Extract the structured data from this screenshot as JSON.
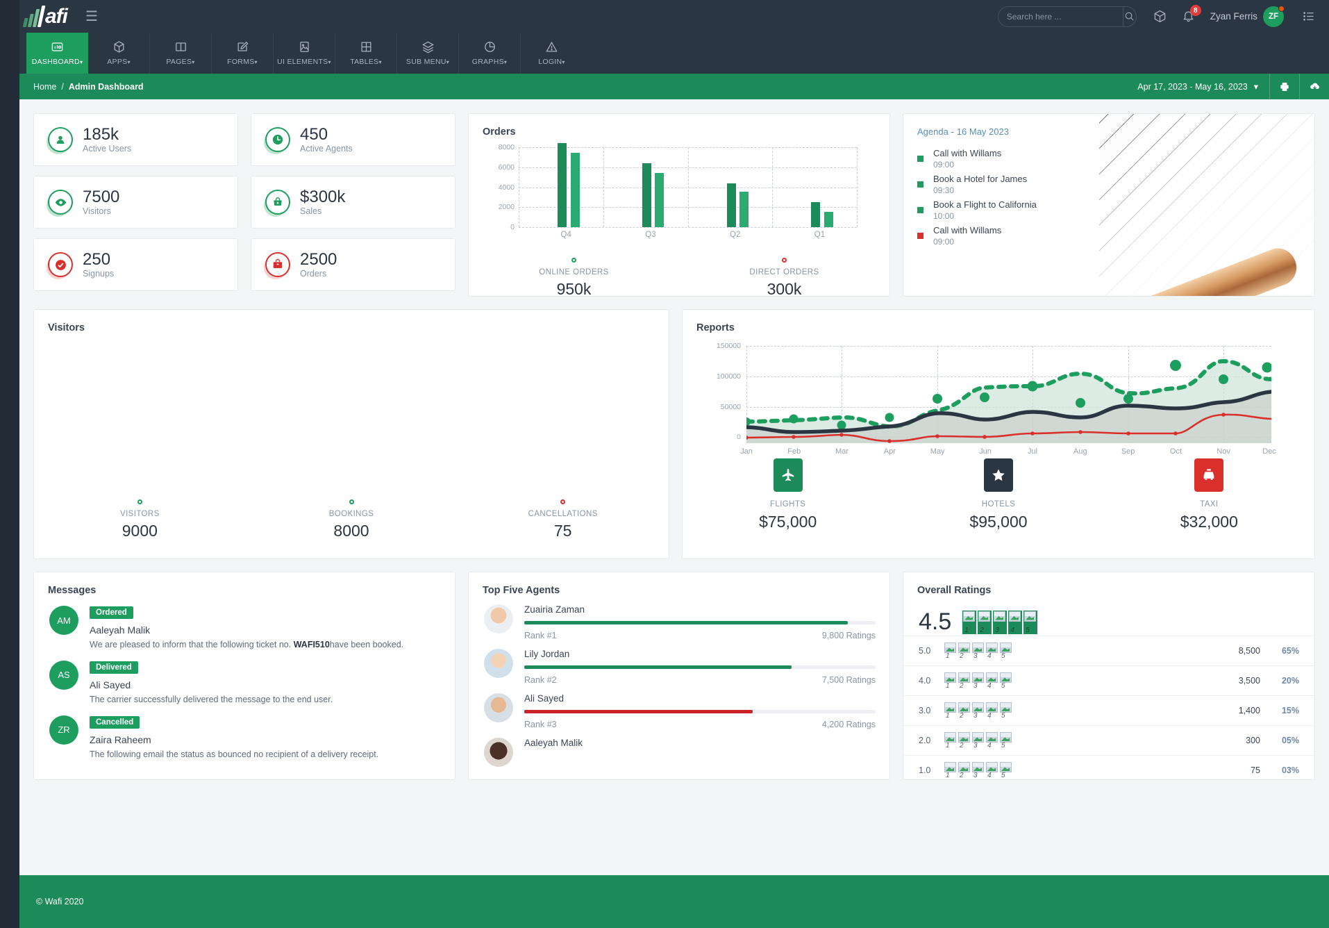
{
  "brand": {
    "name": "afi"
  },
  "header": {
    "search_placeholder": "Search here ...",
    "search_value": "",
    "notification_count": "8",
    "username": "Zyan Ferris",
    "avatar_initials": "ZF"
  },
  "nav": {
    "items": [
      {
        "label": "DASHBOARD",
        "icon": "dashboard-icon",
        "caret": "▾",
        "active": true
      },
      {
        "label": "APPS",
        "icon": "box-icon",
        "caret": "▾",
        "active": false
      },
      {
        "label": "PAGES",
        "icon": "book-icon",
        "caret": "▾",
        "active": false
      },
      {
        "label": "FORMS",
        "icon": "edit-icon",
        "caret": "▾",
        "active": false
      },
      {
        "label": "UI ELEMENTS",
        "icon": "image-icon",
        "caret": "▾",
        "active": false
      },
      {
        "label": "TABLES",
        "icon": "grid-icon",
        "caret": "▾",
        "active": false
      },
      {
        "label": "SUB MENU",
        "icon": "layers-icon",
        "caret": "▾",
        "active": false
      },
      {
        "label": "GRAPHS",
        "icon": "pie-chart-icon",
        "caret": "▾",
        "active": false
      },
      {
        "label": "LOGIN",
        "icon": "alert-icon",
        "caret": "▾",
        "active": false
      }
    ]
  },
  "breadcrumb": {
    "home": "Home",
    "separator": "/",
    "current": "Admin Dashboard"
  },
  "daterange": {
    "label": "Apr 17, 2023 - May 16, 2023",
    "caret": "▾"
  },
  "stats": [
    {
      "value": "185k",
      "label": "Active Users",
      "icon": "user-circle-icon",
      "color": "#1d9e5e"
    },
    {
      "value": "450",
      "label": "Active Agents",
      "icon": "clock-icon",
      "color": "#1d9e5e"
    },
    {
      "value": "7500",
      "label": "Visitors",
      "icon": "eye-icon",
      "color": "#1d9e5e"
    },
    {
      "value": "$300k",
      "label": "Sales",
      "icon": "basket-icon",
      "color": "#1d9e5e"
    },
    {
      "value": "250",
      "label": "Signups",
      "icon": "check-circle-icon",
      "color": "#d9302c"
    },
    {
      "value": "2500",
      "label": "Orders",
      "icon": "briefcase-icon",
      "color": "#d9302c"
    }
  ],
  "orders": {
    "title": "Orders",
    "footer": [
      {
        "label": "ONLINE ORDERS",
        "value": "950k",
        "color": "#1d9e5e"
      },
      {
        "label": "DIRECT ORDERS",
        "value": "300k",
        "color": "#d9302c"
      }
    ]
  },
  "agenda": {
    "title": "Agenda -",
    "date": "16 May 2023",
    "items": [
      {
        "title": "Call with Willams",
        "time": "09:00",
        "color": "#1d9e5e"
      },
      {
        "title": "Book a Hotel for James",
        "time": "09:30",
        "color": "#1d9e5e"
      },
      {
        "title": "Book a Flight to California",
        "time": "10:00",
        "color": "#1d9e5e"
      },
      {
        "title": "Call with Willams",
        "time": "09:00",
        "color": "#d9302c"
      }
    ]
  },
  "visitors": {
    "title": "Visitors",
    "footer": [
      {
        "label": "VISITORS",
        "value": "9000",
        "color": "#1d9e5e"
      },
      {
        "label": "BOOKINGS",
        "value": "8000",
        "color": "#1d9e5e"
      },
      {
        "label": "CANCELLATIONS",
        "value": "75",
        "color": "#d9302c"
      }
    ]
  },
  "reports": {
    "title": "Reports",
    "footer": [
      {
        "label": "FLIGHTS",
        "value": "$75,000",
        "icon": "airplane-icon",
        "color": "#1d8b59"
      },
      {
        "label": "HOTELS",
        "value": "$95,000",
        "icon": "star-icon",
        "color": "#2b3643"
      },
      {
        "label": "TAXI",
        "value": "$32,000",
        "icon": "taxi-icon",
        "color": "#d9302c"
      }
    ]
  },
  "messages": {
    "title": "Messages",
    "items": [
      {
        "initials": "AM",
        "badge": "Ordered",
        "name": "Aaleyah Malik",
        "body_pre": "We are pleased to inform that the following ticket no. ",
        "body_bold": "WAFI510",
        "body_post": "have been booked."
      },
      {
        "initials": "AS",
        "badge": "Delivered",
        "name": "Ali Sayed",
        "body_pre": "The carrier successfully delivered the message to the end user.",
        "body_bold": "",
        "body_post": ""
      },
      {
        "initials": "ZR",
        "badge": "Cancelled",
        "name": "Zaira Raheem",
        "body_pre": "The following email the status as bounced no recipient of a delivery receipt.",
        "body_bold": "",
        "body_post": ""
      }
    ]
  },
  "agents": {
    "title": "Top Five Agents",
    "items": [
      {
        "name": "Zuairia Zaman",
        "rank": "Rank #1",
        "ratings": "9,800 Ratings",
        "percent": 92,
        "color": "#1d8b59"
      },
      {
        "name": "Lily Jordan",
        "rank": "Rank #2",
        "ratings": "7,500 Ratings",
        "percent": 76,
        "color": "#1d8b59"
      },
      {
        "name": "Ali Sayed",
        "rank": "Rank #3",
        "ratings": "4,200 Ratings",
        "percent": 65,
        "color": "#c9242a"
      },
      {
        "name": "Aaleyah Malik",
        "rank": "",
        "ratings": "",
        "percent": 0,
        "color": "#1d8b59"
      }
    ]
  },
  "ratings": {
    "title": "Overall Ratings",
    "average": "4.5",
    "star_labels": [
      "1",
      "2",
      "3",
      "4",
      "5"
    ],
    "rows": [
      {
        "score": "5.0",
        "count": "8,500",
        "percent": "65%"
      },
      {
        "score": "4.0",
        "count": "3,500",
        "percent": "20%"
      },
      {
        "score": "3.0",
        "count": "1,400",
        "percent": "15%"
      },
      {
        "score": "2.0",
        "count": "300",
        "percent": "05%"
      },
      {
        "score": "1.0",
        "count": "75",
        "percent": "03%"
      }
    ]
  },
  "footer": {
    "copyright": "© Wafi 2020"
  },
  "chart_data": [
    {
      "type": "bar",
      "title": "Orders",
      "categories": [
        "Q4",
        "Q3",
        "Q2",
        "Q1"
      ],
      "series": [
        {
          "name": "Online Orders",
          "values": [
            8400,
            6400,
            4400,
            2500
          ],
          "color": "#1d8b59"
        },
        {
          "name": "Direct Orders",
          "values": [
            7450,
            5450,
            3500,
            1550
          ],
          "color": "#2bab71"
        }
      ],
      "ylim": [
        0,
        8000
      ],
      "yticks": [
        0,
        2000,
        4000,
        6000,
        8000
      ],
      "xlabel": "",
      "ylabel": "",
      "grid": true,
      "legend": [
        "ONLINE ORDERS",
        "DIRECT ORDERS"
      ]
    },
    {
      "type": "area",
      "title": "Reports",
      "x": [
        "Jan",
        "Feb",
        "Mar",
        "Apr",
        "May",
        "Jun",
        "Jul",
        "Aug",
        "Sep",
        "Oct",
        "Nov",
        "Dec"
      ],
      "series": [
        {
          "name": "series-green-dotted",
          "color": "#1d9e5e",
          "style": "dotted",
          "values": [
            34000,
            39000,
            29000,
            46000,
            74000,
            77000,
            95000,
            66000,
            74000,
            118000,
            95000,
            114000
          ]
        },
        {
          "name": "series-dark",
          "color": "#2b3643",
          "style": "solid",
          "values": [
            23000,
            15000,
            17000,
            26000,
            45000,
            34000,
            47000,
            37000,
            54000,
            50000,
            63000,
            77000
          ]
        },
        {
          "name": "series-red",
          "color": "#d9302c",
          "style": "solid",
          "values": [
            -1000,
            -500,
            5000,
            -7000,
            2000,
            1500,
            11000,
            15000,
            12000,
            11000,
            45000,
            36000
          ]
        }
      ],
      "ylim": [
        -10000,
        150000
      ],
      "yticks": [
        0,
        50000,
        100000,
        150000
      ],
      "xlabel": "",
      "ylabel": "",
      "grid": true
    },
    {
      "type": "bar",
      "title": "Top Five Agents",
      "categories": [
        "Zuairia Zaman",
        "Lily Jordan",
        "Ali Sayed",
        "Aaleyah Malik"
      ],
      "values": [
        9800,
        7500,
        4200,
        0
      ],
      "ylabel": "Ratings"
    },
    {
      "type": "bar",
      "title": "Overall Ratings",
      "categories": [
        "5.0",
        "4.0",
        "3.0",
        "2.0",
        "1.0"
      ],
      "values": [
        8500,
        3500,
        1400,
        300,
        75
      ],
      "percentages": [
        "65%",
        "20%",
        "15%",
        "05%",
        "03%"
      ]
    }
  ]
}
